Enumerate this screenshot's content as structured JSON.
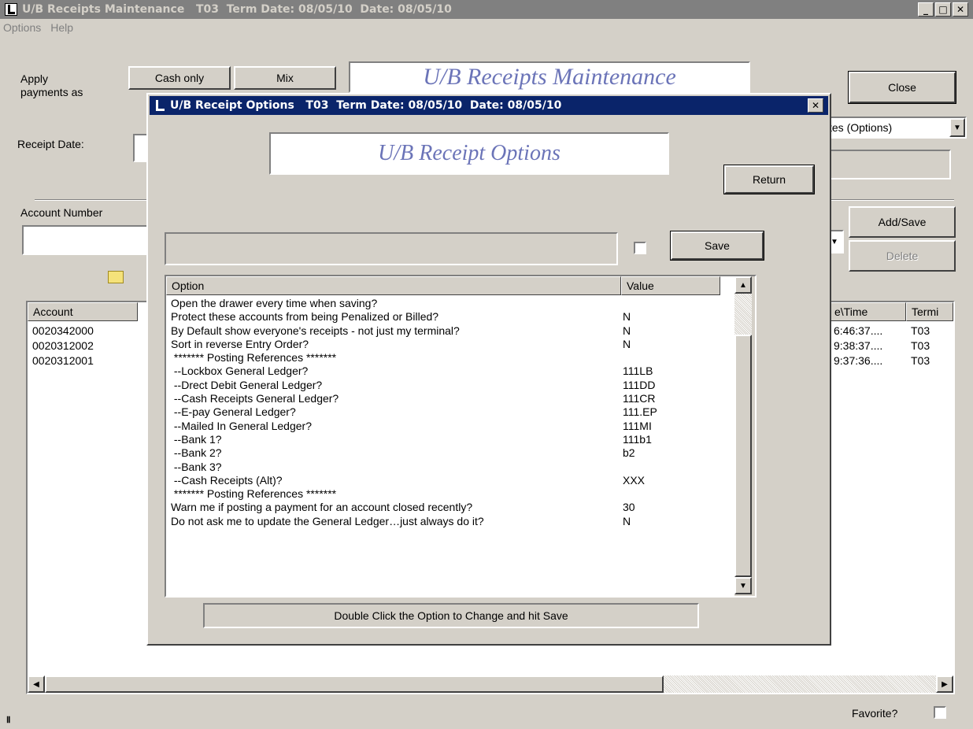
{
  "main": {
    "title": "U/B Receipts Maintenance   T03  Term Date: 08/05/10  Date: 08/05/10",
    "menu": [
      "Options",
      "Help"
    ],
    "apply_label_1": "Apply",
    "apply_label_2": "payments as",
    "cash_only": "Cash only",
    "mix": "Mix",
    "banner": "U/B Receipts Maintenance",
    "close": "Close",
    "receipt_date_label": "Receipt Date:",
    "dropdown_value": "tes (Options)",
    "account_number_label": "Account Number",
    "add_save": "Add/Save",
    "delete": "Delete",
    "columns": [
      "Account",
      "e\\Time",
      "Termi"
    ],
    "rows": [
      {
        "account": "0020342000",
        "time": "6:46:37....",
        "term": "T03"
      },
      {
        "account": "0020312002",
        "time": "9:38:37....",
        "term": "T03"
      },
      {
        "account": "0020312001",
        "time": "9:37:36....",
        "term": "T03"
      }
    ],
    "favorite_label": "Favorite?"
  },
  "dialog": {
    "title": "U/B Receipt Options   T03  Term Date: 08/05/10  Date: 08/05/10",
    "banner": "U/B Receipt Options",
    "return": "Return",
    "save": "Save",
    "col_option": "Option",
    "col_value": "Value",
    "options": [
      {
        "option": "Open the drawer every time when saving?",
        "value": ""
      },
      {
        "option": "Protect these accounts from being Penalized or Billed?",
        "value": "N"
      },
      {
        "option": "By Default show everyone's receipts - not just my terminal?",
        "value": "N"
      },
      {
        "option": "Sort in reverse Entry Order?",
        "value": "N"
      },
      {
        "option": " ******* Posting References *******",
        "value": ""
      },
      {
        "option": " --Lockbox General Ledger?",
        "value": "111LB"
      },
      {
        "option": " --Drect Debit General Ledger?",
        "value": "111DD"
      },
      {
        "option": " --Cash Receipts General Ledger?",
        "value": "111CR"
      },
      {
        "option": " --E-pay General Ledger?",
        "value": "111.EP"
      },
      {
        "option": " --Mailed In General Ledger?",
        "value": "111MI"
      },
      {
        "option": " --Bank 1?",
        "value": "111b1"
      },
      {
        "option": " --Bank 2?",
        "value": "b2"
      },
      {
        "option": " --Bank 3?",
        "value": ""
      },
      {
        "option": " --Cash Receipts (Alt)?",
        "value": "XXX"
      },
      {
        "option": " ******* Posting References *******",
        "value": ""
      },
      {
        "option": "Warn me if posting a payment for an account closed recently?",
        "value": "30"
      },
      {
        "option": "Do not ask me to update the General Ledger…just always do it?",
        "value": "N"
      }
    ],
    "hint": "Double Click the Option to Change and hit Save"
  }
}
